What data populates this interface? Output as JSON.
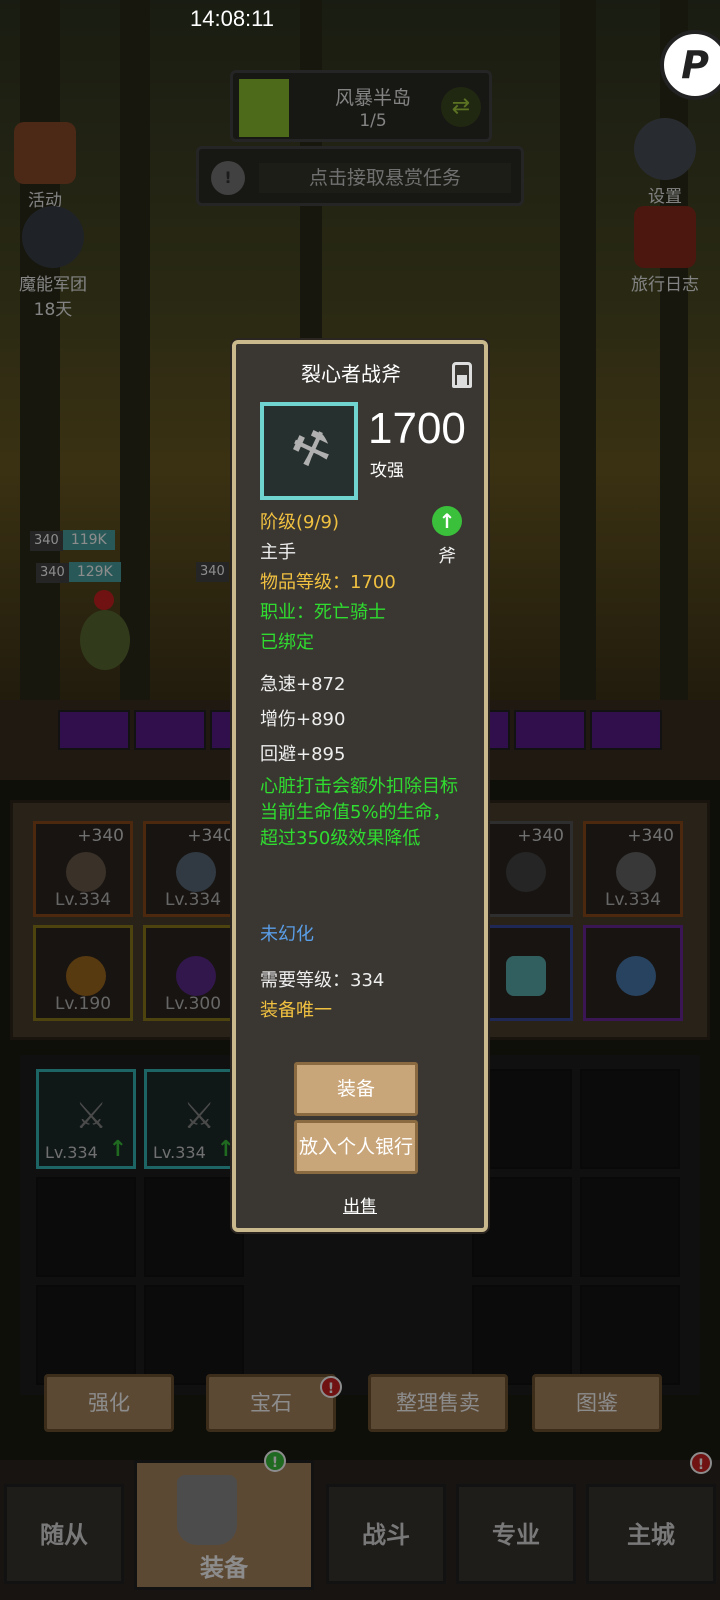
{
  "status": {
    "time": "14:08:11"
  },
  "corner_button": {
    "glyph": "P"
  },
  "zone": {
    "name": "风暴半岛",
    "progress": "1/5"
  },
  "quest": {
    "text": "点击接取悬赏任务"
  },
  "side_left": [
    {
      "label": "活动",
      "sub": ""
    },
    {
      "label": "魔能军团",
      "sub": "18天"
    }
  ],
  "side_right": [
    {
      "label": "设置"
    },
    {
      "label": "旅行日志"
    }
  ],
  "hp_bars": [
    {
      "level": "340",
      "value": "119K"
    },
    {
      "level": "340",
      "value": "129K"
    },
    {
      "level": "340",
      "value": ""
    }
  ],
  "equip_slots": [
    {
      "plus": "+340",
      "level": "Lv.334",
      "color": "#8a4b1a"
    },
    {
      "plus": "+340",
      "level": "Lv.334",
      "color": "#8a4b1a"
    },
    {
      "plus": "+340",
      "level": "",
      "color": "#555"
    },
    {
      "plus": "+340",
      "level": "Lv.334",
      "color": "#8a4b1a"
    },
    {
      "plus": "",
      "level": "Lv.190",
      "color": "#8a7a1a"
    },
    {
      "plus": "",
      "level": "Lv.300",
      "color": "#8a7a1a"
    },
    {
      "plus": "",
      "level": "",
      "color": "#3a4a9a"
    },
    {
      "plus": "",
      "level": "",
      "color": "#6a2a9a"
    }
  ],
  "bag_items": [
    {
      "level": "Lv.334",
      "up": "↑"
    },
    {
      "level": "Lv.334",
      "up": "↑"
    }
  ],
  "actions": [
    {
      "label": "强化",
      "badge": false
    },
    {
      "label": "宝石",
      "badge": true
    },
    {
      "label": "整理售卖",
      "badge": false
    },
    {
      "label": "图鉴",
      "badge": false
    }
  ],
  "tabs": [
    {
      "label": "随从"
    },
    {
      "label": "装备"
    },
    {
      "label": "战斗"
    },
    {
      "label": "专业"
    },
    {
      "label": "主城"
    }
  ],
  "badge_glyph": "!",
  "modal": {
    "title": "裂心者战斧",
    "power": "1700",
    "power_label": "攻强",
    "tier": "阶级(9/9)",
    "slot": "主手",
    "weapon_type": "斧",
    "item_level": "物品等级：1700",
    "class": "职业：死亡骑士",
    "bound": "已绑定",
    "stats": [
      "急速+872",
      "增伤+890",
      "回避+895"
    ],
    "effect": "心脏打击会额外扣除目标当前生命值5%的生命，超过350级效果降低",
    "transmog": "未幻化",
    "required_level": "需要等级：334",
    "unique": "装备唯一",
    "equip_button": "装备",
    "bank_button": "放入个人银行",
    "sell_link": "出售"
  },
  "colors": {
    "quality_border": "#6fd4d0",
    "gold_text": "#f0c040",
    "green_text": "#2fdc2f",
    "blue_text": "#5a9ee8"
  }
}
